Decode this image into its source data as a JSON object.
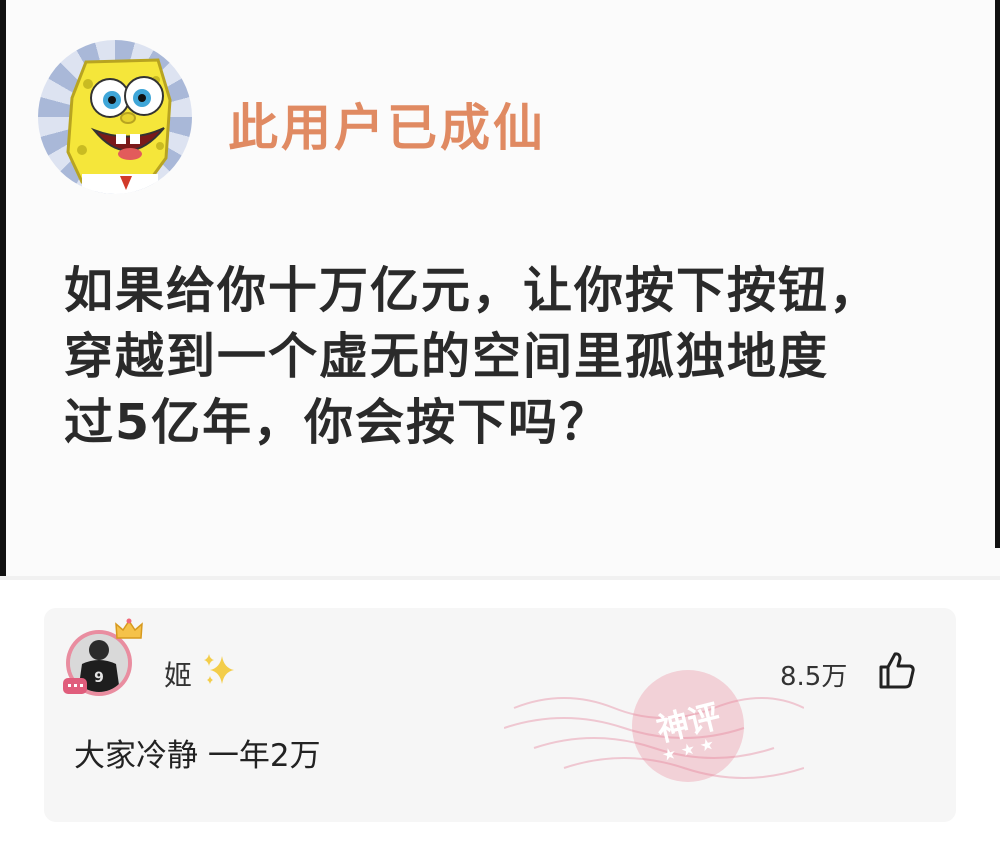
{
  "post": {
    "author_name": "此用户已成仙",
    "lines": [
      "如果给你十万亿元，让你按下按钮，",
      "穿越到一个虚无的空间里孤独地度",
      "过5亿年，你会按下吗？"
    ]
  },
  "comment": {
    "user_name": "姬",
    "avatar_jersey_number": "9",
    "like_count": "8.5万",
    "text": "大家冷静 一年2万",
    "stamp_text": "神评",
    "stamp_stars": "★ ★ ★"
  },
  "colors": {
    "author_name": "#e08a62",
    "post_text": "#2a2a2a",
    "card_background": "#f6f6f6",
    "stamp": "#e88296",
    "avatar_ring": "#e98da0"
  },
  "icons": [
    "spongebob-avatar-icon",
    "crown-icon",
    "badge-icon",
    "sparkle-icon",
    "thumbs-up-icon",
    "stamp-icon"
  ]
}
